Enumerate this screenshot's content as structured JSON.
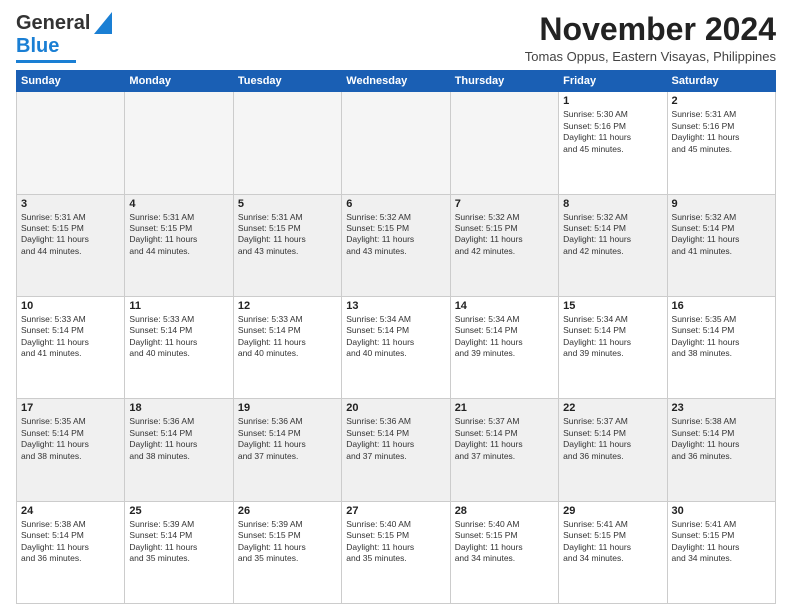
{
  "header": {
    "logo_general": "General",
    "logo_blue": "Blue",
    "month_year": "November 2024",
    "location": "Tomas Oppus, Eastern Visayas, Philippines"
  },
  "days_of_week": [
    "Sunday",
    "Monday",
    "Tuesday",
    "Wednesday",
    "Thursday",
    "Friday",
    "Saturday"
  ],
  "weeks": [
    [
      {
        "day": "",
        "info": "",
        "empty": true
      },
      {
        "day": "",
        "info": "",
        "empty": true
      },
      {
        "day": "",
        "info": "",
        "empty": true
      },
      {
        "day": "",
        "info": "",
        "empty": true
      },
      {
        "day": "",
        "info": "",
        "empty": true
      },
      {
        "day": "1",
        "info": "Sunrise: 5:30 AM\nSunset: 5:16 PM\nDaylight: 11 hours\nand 45 minutes.",
        "empty": false
      },
      {
        "day": "2",
        "info": "Sunrise: 5:31 AM\nSunset: 5:16 PM\nDaylight: 11 hours\nand 45 minutes.",
        "empty": false
      }
    ],
    [
      {
        "day": "3",
        "info": "Sunrise: 5:31 AM\nSunset: 5:15 PM\nDaylight: 11 hours\nand 44 minutes.",
        "empty": false
      },
      {
        "day": "4",
        "info": "Sunrise: 5:31 AM\nSunset: 5:15 PM\nDaylight: 11 hours\nand 44 minutes.",
        "empty": false
      },
      {
        "day": "5",
        "info": "Sunrise: 5:31 AM\nSunset: 5:15 PM\nDaylight: 11 hours\nand 43 minutes.",
        "empty": false
      },
      {
        "day": "6",
        "info": "Sunrise: 5:32 AM\nSunset: 5:15 PM\nDaylight: 11 hours\nand 43 minutes.",
        "empty": false
      },
      {
        "day": "7",
        "info": "Sunrise: 5:32 AM\nSunset: 5:15 PM\nDaylight: 11 hours\nand 42 minutes.",
        "empty": false
      },
      {
        "day": "8",
        "info": "Sunrise: 5:32 AM\nSunset: 5:14 PM\nDaylight: 11 hours\nand 42 minutes.",
        "empty": false
      },
      {
        "day": "9",
        "info": "Sunrise: 5:32 AM\nSunset: 5:14 PM\nDaylight: 11 hours\nand 41 minutes.",
        "empty": false
      }
    ],
    [
      {
        "day": "10",
        "info": "Sunrise: 5:33 AM\nSunset: 5:14 PM\nDaylight: 11 hours\nand 41 minutes.",
        "empty": false
      },
      {
        "day": "11",
        "info": "Sunrise: 5:33 AM\nSunset: 5:14 PM\nDaylight: 11 hours\nand 40 minutes.",
        "empty": false
      },
      {
        "day": "12",
        "info": "Sunrise: 5:33 AM\nSunset: 5:14 PM\nDaylight: 11 hours\nand 40 minutes.",
        "empty": false
      },
      {
        "day": "13",
        "info": "Sunrise: 5:34 AM\nSunset: 5:14 PM\nDaylight: 11 hours\nand 40 minutes.",
        "empty": false
      },
      {
        "day": "14",
        "info": "Sunrise: 5:34 AM\nSunset: 5:14 PM\nDaylight: 11 hours\nand 39 minutes.",
        "empty": false
      },
      {
        "day": "15",
        "info": "Sunrise: 5:34 AM\nSunset: 5:14 PM\nDaylight: 11 hours\nand 39 minutes.",
        "empty": false
      },
      {
        "day": "16",
        "info": "Sunrise: 5:35 AM\nSunset: 5:14 PM\nDaylight: 11 hours\nand 38 minutes.",
        "empty": false
      }
    ],
    [
      {
        "day": "17",
        "info": "Sunrise: 5:35 AM\nSunset: 5:14 PM\nDaylight: 11 hours\nand 38 minutes.",
        "empty": false
      },
      {
        "day": "18",
        "info": "Sunrise: 5:36 AM\nSunset: 5:14 PM\nDaylight: 11 hours\nand 38 minutes.",
        "empty": false
      },
      {
        "day": "19",
        "info": "Sunrise: 5:36 AM\nSunset: 5:14 PM\nDaylight: 11 hours\nand 37 minutes.",
        "empty": false
      },
      {
        "day": "20",
        "info": "Sunrise: 5:36 AM\nSunset: 5:14 PM\nDaylight: 11 hours\nand 37 minutes.",
        "empty": false
      },
      {
        "day": "21",
        "info": "Sunrise: 5:37 AM\nSunset: 5:14 PM\nDaylight: 11 hours\nand 37 minutes.",
        "empty": false
      },
      {
        "day": "22",
        "info": "Sunrise: 5:37 AM\nSunset: 5:14 PM\nDaylight: 11 hours\nand 36 minutes.",
        "empty": false
      },
      {
        "day": "23",
        "info": "Sunrise: 5:38 AM\nSunset: 5:14 PM\nDaylight: 11 hours\nand 36 minutes.",
        "empty": false
      }
    ],
    [
      {
        "day": "24",
        "info": "Sunrise: 5:38 AM\nSunset: 5:14 PM\nDaylight: 11 hours\nand 36 minutes.",
        "empty": false
      },
      {
        "day": "25",
        "info": "Sunrise: 5:39 AM\nSunset: 5:14 PM\nDaylight: 11 hours\nand 35 minutes.",
        "empty": false
      },
      {
        "day": "26",
        "info": "Sunrise: 5:39 AM\nSunset: 5:15 PM\nDaylight: 11 hours\nand 35 minutes.",
        "empty": false
      },
      {
        "day": "27",
        "info": "Sunrise: 5:40 AM\nSunset: 5:15 PM\nDaylight: 11 hours\nand 35 minutes.",
        "empty": false
      },
      {
        "day": "28",
        "info": "Sunrise: 5:40 AM\nSunset: 5:15 PM\nDaylight: 11 hours\nand 34 minutes.",
        "empty": false
      },
      {
        "day": "29",
        "info": "Sunrise: 5:41 AM\nSunset: 5:15 PM\nDaylight: 11 hours\nand 34 minutes.",
        "empty": false
      },
      {
        "day": "30",
        "info": "Sunrise: 5:41 AM\nSunset: 5:15 PM\nDaylight: 11 hours\nand 34 minutes.",
        "empty": false
      }
    ]
  ]
}
